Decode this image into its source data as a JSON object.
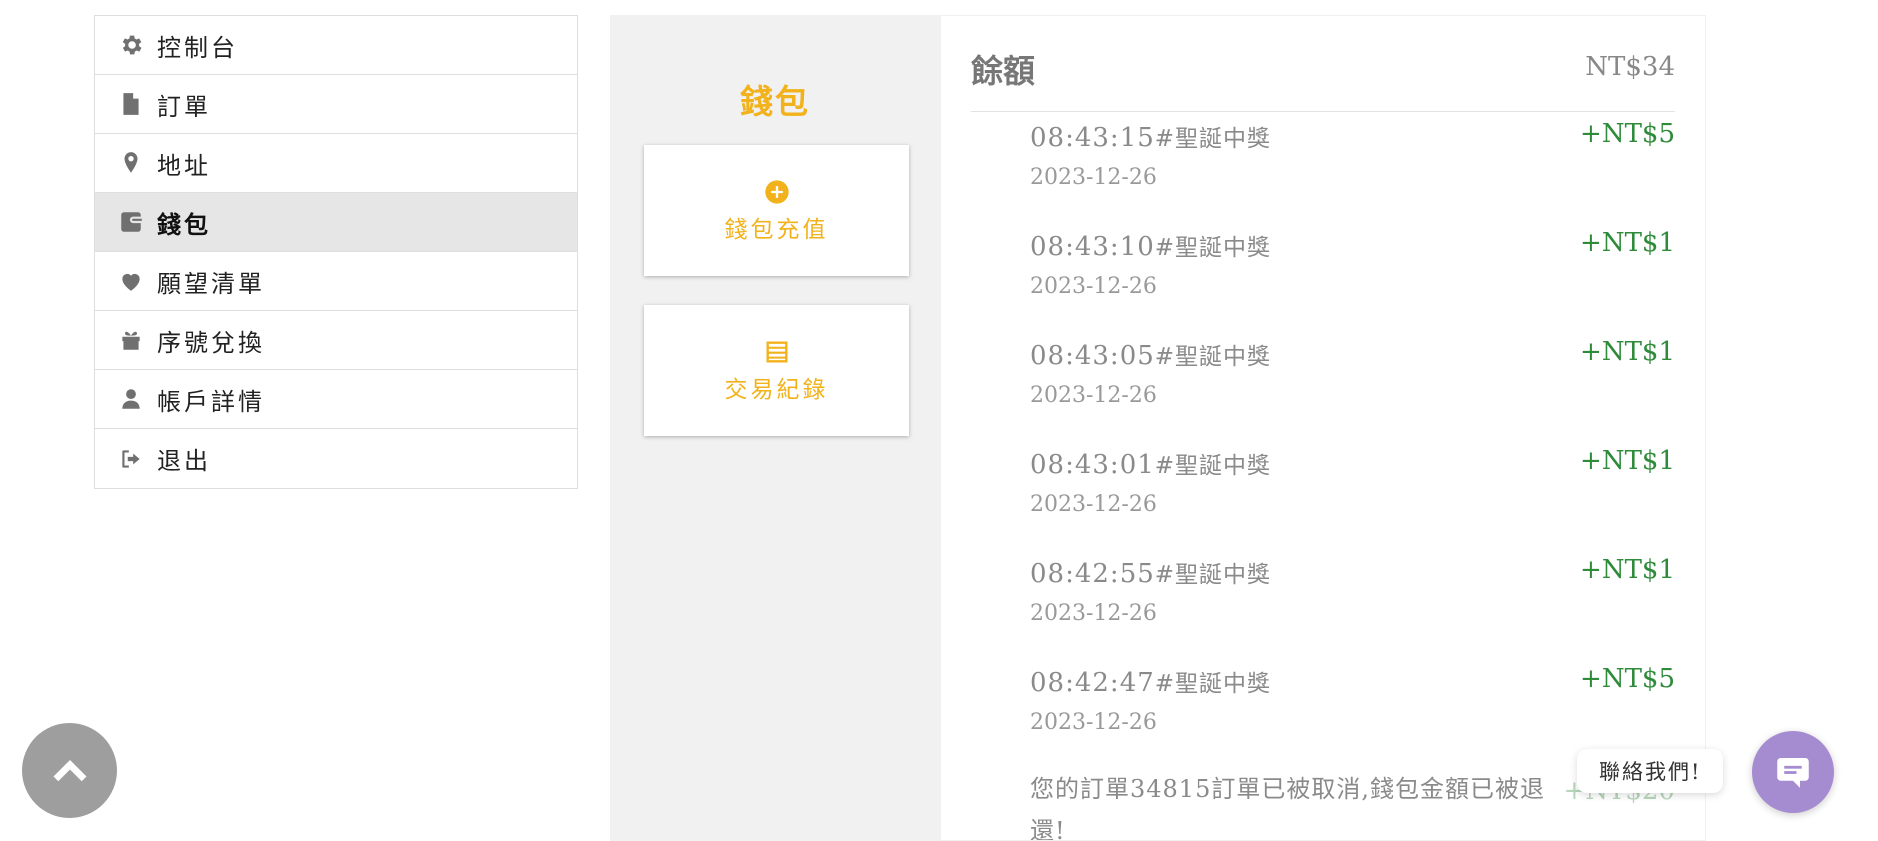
{
  "sidebar": {
    "items": [
      {
        "label": "控制台",
        "icon": "gear-icon"
      },
      {
        "label": "訂單",
        "icon": "document-icon"
      },
      {
        "label": "地址",
        "icon": "map-pin-icon"
      },
      {
        "label": "錢包",
        "icon": "wallet-icon",
        "active": true
      },
      {
        "label": "願望清單",
        "icon": "heart-icon"
      },
      {
        "label": "序號兌換",
        "icon": "gift-icon"
      },
      {
        "label": "帳戶詳情",
        "icon": "user-icon"
      },
      {
        "label": "退出",
        "icon": "logout-icon"
      }
    ]
  },
  "wallet": {
    "title": "錢包",
    "topup_label": "錢包充值",
    "history_label": "交易紀錄"
  },
  "balance": {
    "title": "餘額",
    "amount": "NT$34"
  },
  "transactions": [
    {
      "time": "08:43:15",
      "desc": "#聖誕中獎",
      "date": "2023-12-26",
      "amount": "+NT$5"
    },
    {
      "time": "08:43:10",
      "desc": "#聖誕中獎",
      "date": "2023-12-26",
      "amount": "+NT$1"
    },
    {
      "time": "08:43:05",
      "desc": "#聖誕中獎",
      "date": "2023-12-26",
      "amount": "+NT$1"
    },
    {
      "time": "08:43:01",
      "desc": "#聖誕中獎",
      "date": "2023-12-26",
      "amount": "+NT$1"
    },
    {
      "time": "08:42:55",
      "desc": "#聖誕中獎",
      "date": "2023-12-26",
      "amount": "+NT$1"
    },
    {
      "time": "08:42:47",
      "desc": "#聖誕中獎",
      "date": "2023-12-26",
      "amount": "+NT$5"
    }
  ],
  "last_transaction": {
    "text": "您的訂單34815訂單已被取消,錢包金額已被退還!",
    "amount": "+NT$20"
  },
  "contact": {
    "label": "聯絡我們!"
  },
  "colors": {
    "accent": "#f2b21b",
    "positive": "#2e8b3a",
    "contact": "#a58bd0"
  }
}
